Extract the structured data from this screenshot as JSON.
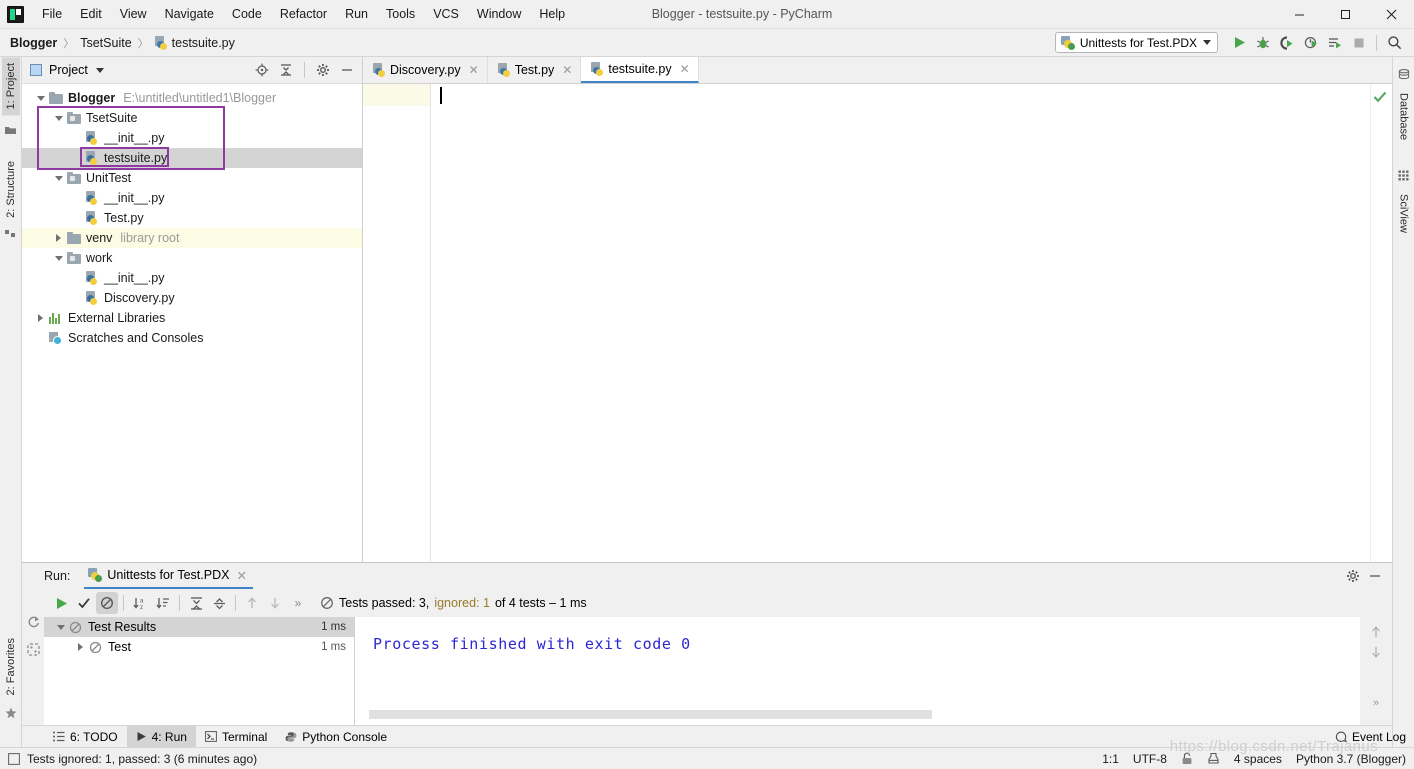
{
  "window": {
    "title": "Blogger - testsuite.py - PyCharm",
    "minimize": "—",
    "maximize": "▢",
    "close": "✕"
  },
  "menubar": {
    "items": [
      {
        "label": "File"
      },
      {
        "label": "Edit"
      },
      {
        "label": "View"
      },
      {
        "label": "Navigate"
      },
      {
        "label": "Code"
      },
      {
        "label": "Refactor"
      },
      {
        "label": "Run"
      },
      {
        "label": "Tools"
      },
      {
        "label": "VCS"
      },
      {
        "label": "Window"
      },
      {
        "label": "Help"
      }
    ]
  },
  "breadcrumb": {
    "project": "Blogger",
    "folder": "TsetSuite",
    "file": "testsuite.py",
    "separator": "〉"
  },
  "toolbar": {
    "run_config": "Unittests for Test.PDX",
    "run_icon": "run-icon",
    "debug_icon": "debug-icon",
    "coverage_icon": "run-with-coverage-icon",
    "profile_icon": "profile-icon",
    "run_tests_icon": "run-tests-icon",
    "stop_icon": "stop-icon",
    "search_icon": "search-everywhere-icon"
  },
  "left_strip": {
    "tabs": [
      {
        "label": "1: Project",
        "icon": "project-icon",
        "active": true
      },
      {
        "label": "2: Structure",
        "icon": "structure-icon",
        "active": false
      }
    ],
    "bottom_tabs": [
      {
        "label": "2: Favorites",
        "icon": "star-icon"
      }
    ]
  },
  "right_strip": {
    "tabs": [
      {
        "label": "Database",
        "icon": "database-icon"
      },
      {
        "label": "SciView",
        "icon": "sciview-icon"
      }
    ]
  },
  "project_panel": {
    "title": "Project",
    "toolbar_icons": [
      "locate-icon",
      "collapse-all-icon",
      "settings-gear-icon",
      "hide-icon"
    ],
    "tree": [
      {
        "depth": 0,
        "arrow": "down",
        "icon": "folder-icon",
        "name": "Blogger",
        "bold": true,
        "extra": "E:\\untitled\\untitled1\\Blogger",
        "extra_kind": "path",
        "selected": false,
        "highlight": false
      },
      {
        "depth": 1,
        "arrow": "down",
        "icon": "source-folder-icon",
        "name": "TsetSuite",
        "bold": false,
        "extra": "",
        "extra_kind": "",
        "selected": false,
        "highlight": false
      },
      {
        "depth": 2,
        "arrow": "none",
        "icon": "python-file-icon",
        "name": "__init__.py",
        "bold": false,
        "extra": "",
        "extra_kind": "",
        "selected": false,
        "highlight": false
      },
      {
        "depth": 2,
        "arrow": "none",
        "icon": "python-file-icon",
        "name": "testsuite.py",
        "bold": false,
        "extra": "",
        "extra_kind": "",
        "selected": true,
        "highlight": false
      },
      {
        "depth": 1,
        "arrow": "down",
        "icon": "source-folder-icon",
        "name": "UnitTest",
        "bold": false,
        "extra": "",
        "extra_kind": "",
        "selected": false,
        "highlight": false
      },
      {
        "depth": 2,
        "arrow": "none",
        "icon": "python-file-icon",
        "name": "__init__.py",
        "bold": false,
        "extra": "",
        "extra_kind": "",
        "selected": false,
        "highlight": false
      },
      {
        "depth": 2,
        "arrow": "none",
        "icon": "python-file-icon",
        "name": "Test.py",
        "bold": false,
        "extra": "",
        "extra_kind": "",
        "selected": false,
        "highlight": false
      },
      {
        "depth": 1,
        "arrow": "right",
        "icon": "folder-icon",
        "name": "venv",
        "bold": false,
        "extra": "library root",
        "extra_kind": "libroot",
        "selected": false,
        "highlight": true
      },
      {
        "depth": 1,
        "arrow": "down",
        "icon": "source-folder-icon",
        "name": "work",
        "bold": false,
        "extra": "",
        "extra_kind": "",
        "selected": false,
        "highlight": false
      },
      {
        "depth": 2,
        "arrow": "none",
        "icon": "python-file-icon",
        "name": "__init__.py",
        "bold": false,
        "extra": "",
        "extra_kind": "",
        "selected": false,
        "highlight": false
      },
      {
        "depth": 2,
        "arrow": "none",
        "icon": "python-file-icon",
        "name": "Discovery.py",
        "bold": false,
        "extra": "",
        "extra_kind": "",
        "selected": false,
        "highlight": false
      },
      {
        "depth": 0,
        "arrow": "right",
        "icon": "external-lib-icon",
        "name": "External Libraries",
        "bold": false,
        "extra": "",
        "extra_kind": "",
        "selected": false,
        "highlight": false
      },
      {
        "depth": 0,
        "arrow": "none",
        "icon": "scratches-icon",
        "name": "Scratches and Consoles",
        "bold": false,
        "extra": "",
        "extra_kind": "",
        "selected": false,
        "highlight": false
      }
    ]
  },
  "editor": {
    "tabs": [
      {
        "label": "Discovery.py",
        "active": false,
        "close": "✕"
      },
      {
        "label": "Test.py",
        "active": false,
        "close": "✕"
      },
      {
        "label": "testsuite.py",
        "active": true,
        "close": "✕"
      }
    ],
    "content": "",
    "inspection_status": "ok-check-icon"
  },
  "run_panel": {
    "label": "Run:",
    "tab": "Unittests for Test.PDX",
    "tab_close": "✕",
    "toolbar_icons": [
      "rerun-icon",
      "show-passed-icon",
      "show-ignored-icon",
      "sort-alphabetically-icon",
      "sort-by-duration-icon",
      "expand-all-icon",
      "collapse-all-icon",
      "prev-failed-icon",
      "next-failed-icon",
      "more-icon"
    ],
    "status": {
      "prefix": "Tests passed: 3,",
      "ignored": "ignored: 1",
      "suffix": "of 4 tests – 1 ms"
    },
    "tests": [
      {
        "depth": 0,
        "arrow": "down",
        "name": "Test Results",
        "time": "1 ms",
        "selected": true
      },
      {
        "depth": 1,
        "arrow": "right",
        "name": "Test",
        "time": "1 ms",
        "selected": false
      }
    ],
    "console_output": "Process finished with exit code 0",
    "settings_icon": "settings-gear-icon",
    "hide_icon": "hide-icon"
  },
  "tool_windows": [
    {
      "label": "6: TODO",
      "icon": "todo-icon",
      "active": false
    },
    {
      "label": "4: Run",
      "icon": "run-icon",
      "active": true
    },
    {
      "label": "Terminal",
      "icon": "terminal-icon",
      "active": false
    },
    {
      "label": "Python Console",
      "icon": "python-console-icon",
      "active": false
    }
  ],
  "event_log": {
    "label": "Event Log",
    "icon": "event-log-icon"
  },
  "statusbar": {
    "message": "Tests ignored: 1, passed: 3 (6 minutes ago)",
    "caret": "1:1",
    "encoding": "UTF-8",
    "lock_icon": "lock-icon",
    "inspection_icon": "inspection-level-icon",
    "indent": "4 spaces",
    "interpreter": "Python 3.7 (Blogger)"
  },
  "watermark": "https://blog.csdn.net/Trajanus",
  "colors": {
    "accent": "#4083c9",
    "annotation": "#8e3a9e",
    "console_text": "#2a28d1",
    "ignored": "#9a7b2e",
    "selection": "#d4d4d4",
    "venv_highlight": "#fcfbe3"
  }
}
